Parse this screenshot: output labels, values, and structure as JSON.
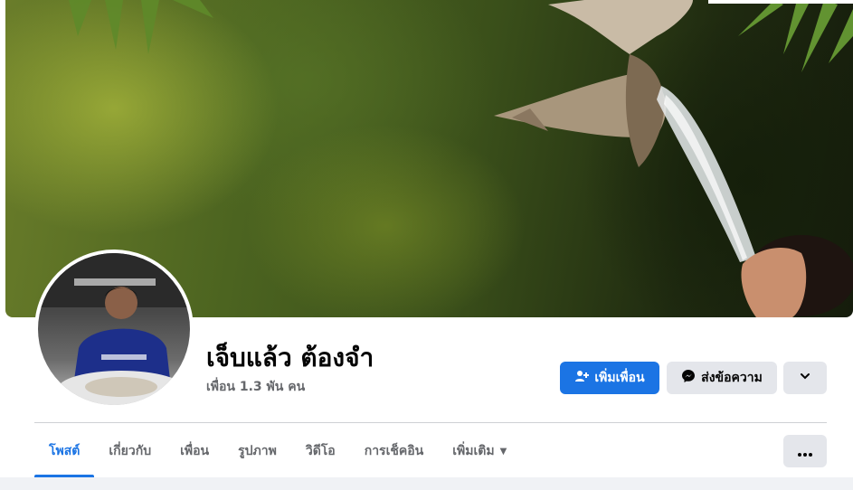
{
  "profile": {
    "name": "เจ็บแล้ว ต้องจำ",
    "friends_count": "เพื่อน 1.3 พัน คน"
  },
  "actions": {
    "add_friend": "เพิ่มเพื่อน",
    "message": "ส่งข้อความ"
  },
  "tabs": [
    {
      "label": "โพสต์",
      "active": true
    },
    {
      "label": "เกี่ยวกับ",
      "active": false
    },
    {
      "label": "เพื่อน",
      "active": false
    },
    {
      "label": "รูปภาพ",
      "active": false
    },
    {
      "label": "วิดีโอ",
      "active": false
    },
    {
      "label": "การเช็คอิน",
      "active": false
    },
    {
      "label": "เพิ่มเติม",
      "active": false
    }
  ],
  "colors": {
    "accent": "#1b74e4",
    "secondary_button": "#e4e6eb",
    "text_primary": "#050505",
    "text_secondary": "#65676b"
  },
  "icons": {
    "add_friend": "person-plus-icon",
    "message": "messenger-icon",
    "more_dropdown": "chevron-down-icon",
    "tab_more": "caret-down-icon",
    "overflow": "ellipsis-icon"
  }
}
